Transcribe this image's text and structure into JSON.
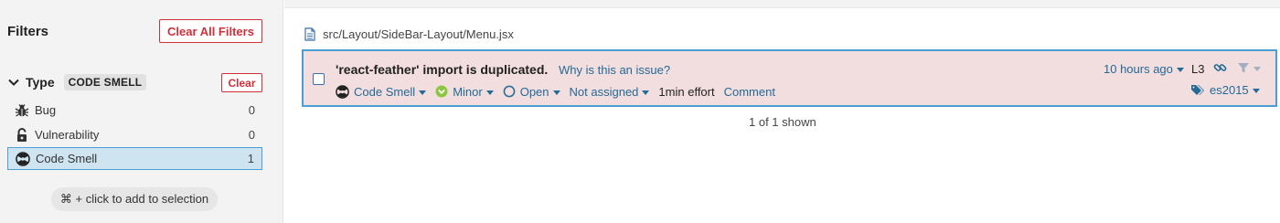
{
  "sidebar": {
    "title": "Filters",
    "clear_all_label": "Clear All Filters",
    "facet": {
      "name": "Type",
      "badge": "CODE SMELL",
      "clear_label": "Clear",
      "items": [
        {
          "label": "Bug",
          "count": "0",
          "icon": "bug-icon"
        },
        {
          "label": "Vulnerability",
          "count": "0",
          "icon": "lock-icon"
        },
        {
          "label": "Code Smell",
          "count": "1",
          "icon": "code-smell-icon",
          "selected": true
        }
      ]
    },
    "hint": "⌘ + click to add to selection"
  },
  "main": {
    "file_path": "src/Layout/SideBar-Layout/Menu.jsx",
    "issue": {
      "message": "'react-feather' import is duplicated.",
      "why_link": "Why is this an issue?",
      "type": "Code Smell",
      "severity": "Minor",
      "status": "Open",
      "assignee": "Not assigned",
      "effort": "1min effort",
      "comment_label": "Comment",
      "age": "10 hours ago",
      "line": "L3",
      "tag": "es2015"
    },
    "shown_text": "1 of 1 shown"
  },
  "colors": {
    "accent": "#236a97",
    "danger": "#d02f3a",
    "issue_bg": "#f2dede",
    "selected_bg": "#cfe4f1",
    "minor_green": "#8cc63f"
  }
}
